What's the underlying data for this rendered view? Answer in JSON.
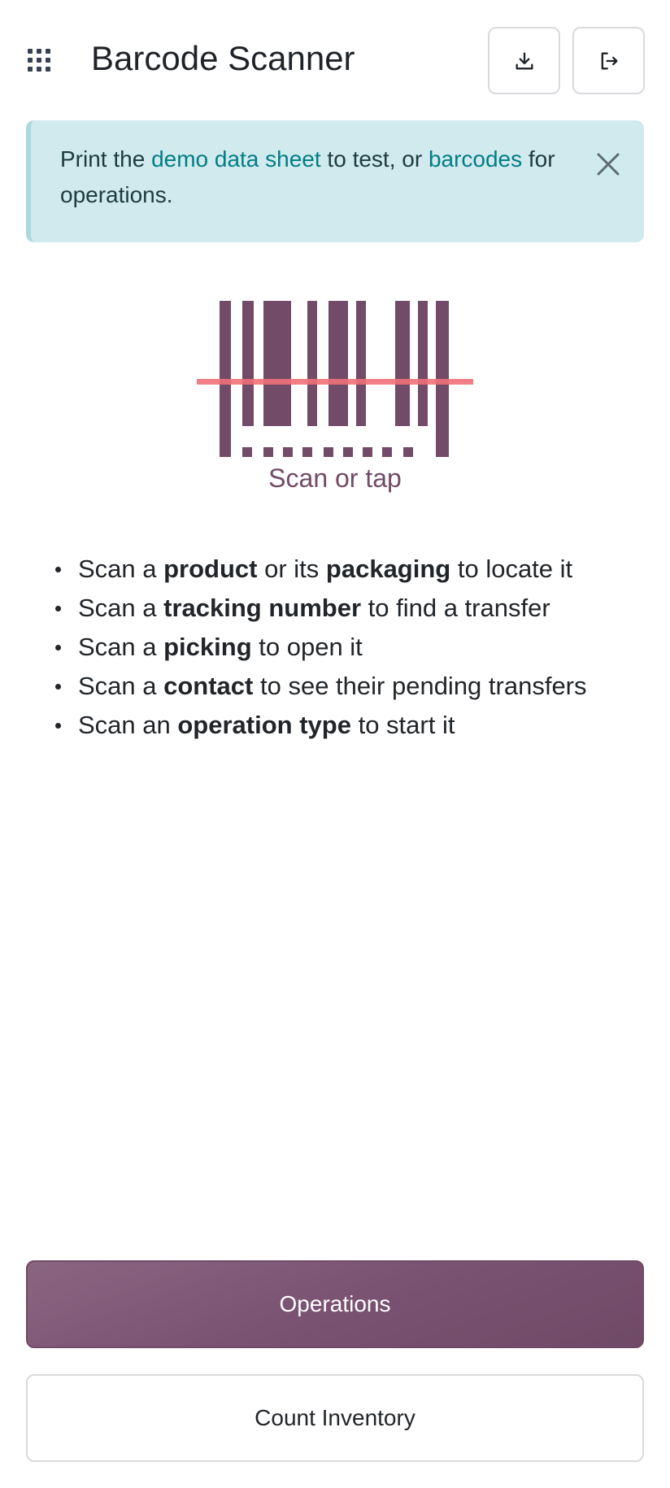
{
  "header": {
    "title": "Barcode Scanner",
    "apps_icon": "apps-grid-icon",
    "download_icon": "download-icon",
    "logout_icon": "logout-icon"
  },
  "alert": {
    "text_1": "Print the ",
    "link_demo": "demo data sheet",
    "text_2": " to test, or ",
    "link_barcodes": "barcodes",
    "text_3": " for operations.",
    "close_icon": "close-icon"
  },
  "scanner": {
    "label": "Scan or tap",
    "icon": "barcode-icon",
    "bar_color": "#714b67",
    "scan_line_color": "#f07178"
  },
  "instructions": [
    {
      "pre": "Scan a ",
      "b1": "product",
      "mid": " or its ",
      "b2": "packaging",
      "post": " to locate it"
    },
    {
      "pre": "Scan a ",
      "b1": "tracking number",
      "mid": " to find a transfer",
      "b2": "",
      "post": ""
    },
    {
      "pre": "Scan a ",
      "b1": "picking",
      "mid": " to open it",
      "b2": "",
      "post": ""
    },
    {
      "pre": "Scan a ",
      "b1": "contact",
      "mid": " to see their pending transfers",
      "b2": "",
      "post": ""
    },
    {
      "pre": "Scan an ",
      "b1": "operation type",
      "mid": " to start it",
      "b2": "",
      "post": ""
    }
  ],
  "buttons": {
    "operations": "Operations",
    "count_inventory": "Count Inventory"
  },
  "colors": {
    "brand": "#714b67",
    "link": "#017e84",
    "alert_bg": "#d0eaee"
  }
}
